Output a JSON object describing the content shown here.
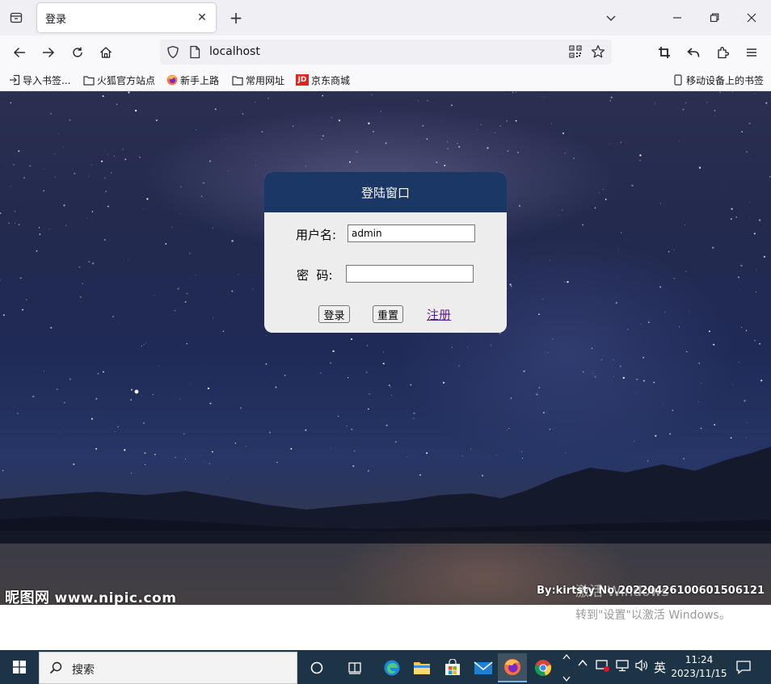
{
  "browser": {
    "tab": {
      "title": "登录"
    },
    "address": "localhost",
    "bookmarks": [
      {
        "label": "导入书签...",
        "icon": "import-icon"
      },
      {
        "label": "火狐官方站点",
        "icon": "folder-icon"
      },
      {
        "label": "新手上路",
        "icon": "firefox-icon"
      },
      {
        "label": "常用网址",
        "icon": "folder-icon"
      },
      {
        "label": "京东商城",
        "icon": "jd-icon"
      }
    ],
    "mobile_bookmarks": "移动设备上的书签"
  },
  "page": {
    "login": {
      "title": "登陆窗口",
      "username_label": "用户名:",
      "username_value": "admin",
      "password_label": "密  码:",
      "password_value": "",
      "login_button": "登录",
      "reset_button": "重置",
      "register_link": "注册"
    },
    "watermark_left_name": "昵图网",
    "watermark_left_site": "www.nipic.com",
    "watermark_right": "By:kirtsty No.20220426100601506121"
  },
  "windows": {
    "activate_title": "激活 Windows",
    "activate_hint": "转到\"设置\"以激活 Windows。",
    "search_placeholder": "搜索",
    "ime": "英",
    "time": "11:24",
    "date": "2023/11/15"
  },
  "colors": {
    "login_header": "#1a3766",
    "login_body": "#ededed",
    "link_visited": "#551a8b",
    "taskbar": "#1d3446"
  }
}
